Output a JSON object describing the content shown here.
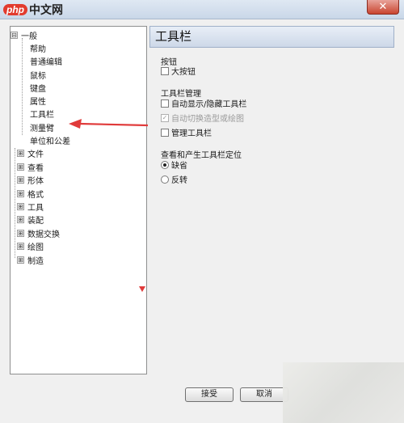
{
  "watermark": {
    "logo": "php",
    "site": "中文网"
  },
  "window": {
    "close_label": "✕"
  },
  "tree": {
    "root": {
      "label": "一般",
      "expander": "⊟"
    },
    "children": [
      "帮助",
      "普通编辑",
      "鼠标",
      "键盘",
      "属性",
      "工具栏",
      "测量臂",
      "单位和公差"
    ],
    "collapsed": [
      "文件",
      "查看",
      "形体",
      "格式",
      "工具",
      "装配",
      "数据交换",
      "绘图",
      "制造"
    ],
    "collapsed_expander": "⊞"
  },
  "panel": {
    "title": "工具栏",
    "buttons_section": {
      "title": "按钮",
      "large_buttons": {
        "label": "大按钮",
        "checked": false
      }
    },
    "manager_section": {
      "title": "工具栏管理",
      "auto_show": {
        "label": "自动显示/隐藏工具栏",
        "checked": false
      },
      "auto_switch": {
        "label": "自动切换造型或绘图",
        "checked": true,
        "disabled": true
      },
      "manage": {
        "label": "管理工具栏",
        "checked": false
      }
    },
    "position_section": {
      "title": "查看和产生工具栏定位",
      "default": {
        "label": "缺省",
        "selected": true
      },
      "reverse": {
        "label": "反转",
        "selected": false
      }
    }
  },
  "footer": {
    "ok_label": "接受",
    "cancel_label": "取消"
  },
  "colors": {
    "annotation_arrow": "#e03a3a",
    "titlebar": "#c9d7e8"
  }
}
